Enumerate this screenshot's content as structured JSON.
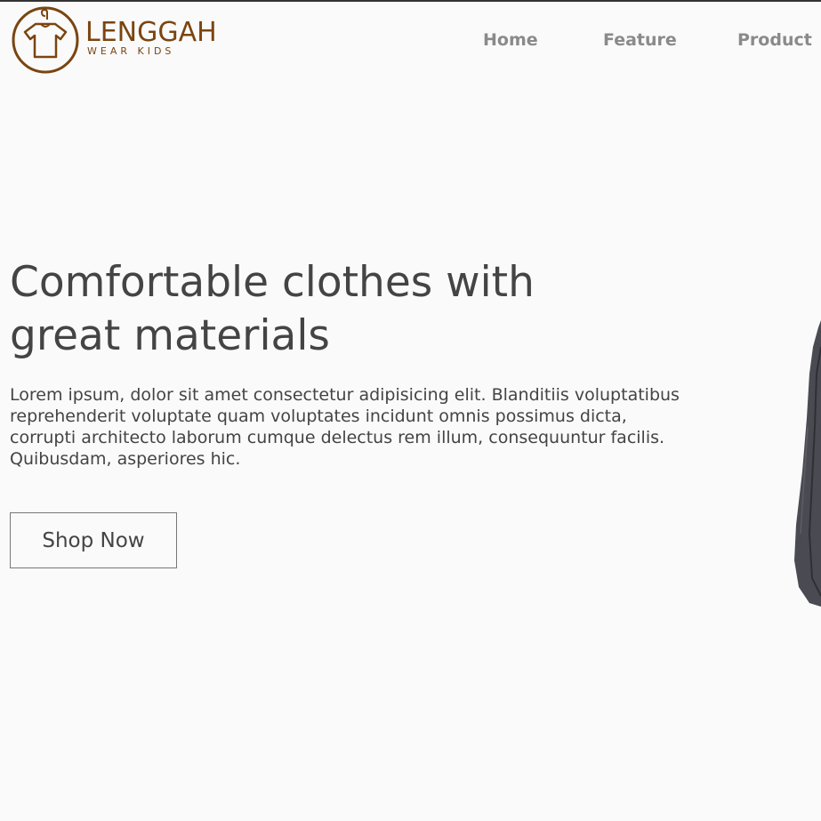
{
  "logo": {
    "brand": "LENGGAH",
    "tagline": "WEAR KIDS",
    "icon": "shirt-hanger-icon",
    "color": "#7a4510"
  },
  "nav": {
    "items": [
      {
        "label": "Home"
      },
      {
        "label": "Feature"
      },
      {
        "label": "Product"
      }
    ]
  },
  "hero": {
    "headline_line1": "Comfortable clothes with",
    "headline_line2": "great materials",
    "description": "Lorem ipsum, dolor sit amet consectetur adipisicing elit. Blanditiis voluptatibus reprehenderit voluptate quam voluptates incidunt omnis possimus dicta, corrupti architecto laborum cumque delectus rem illum, consequuntur facilis. Quibusdam, asperiores hic.",
    "cta_label": "Shop Now",
    "image": "jacket-photo"
  },
  "colors": {
    "background": "#fafafa",
    "text": "#444444",
    "nav": "#8a8a8a",
    "brand": "#7a4510"
  }
}
